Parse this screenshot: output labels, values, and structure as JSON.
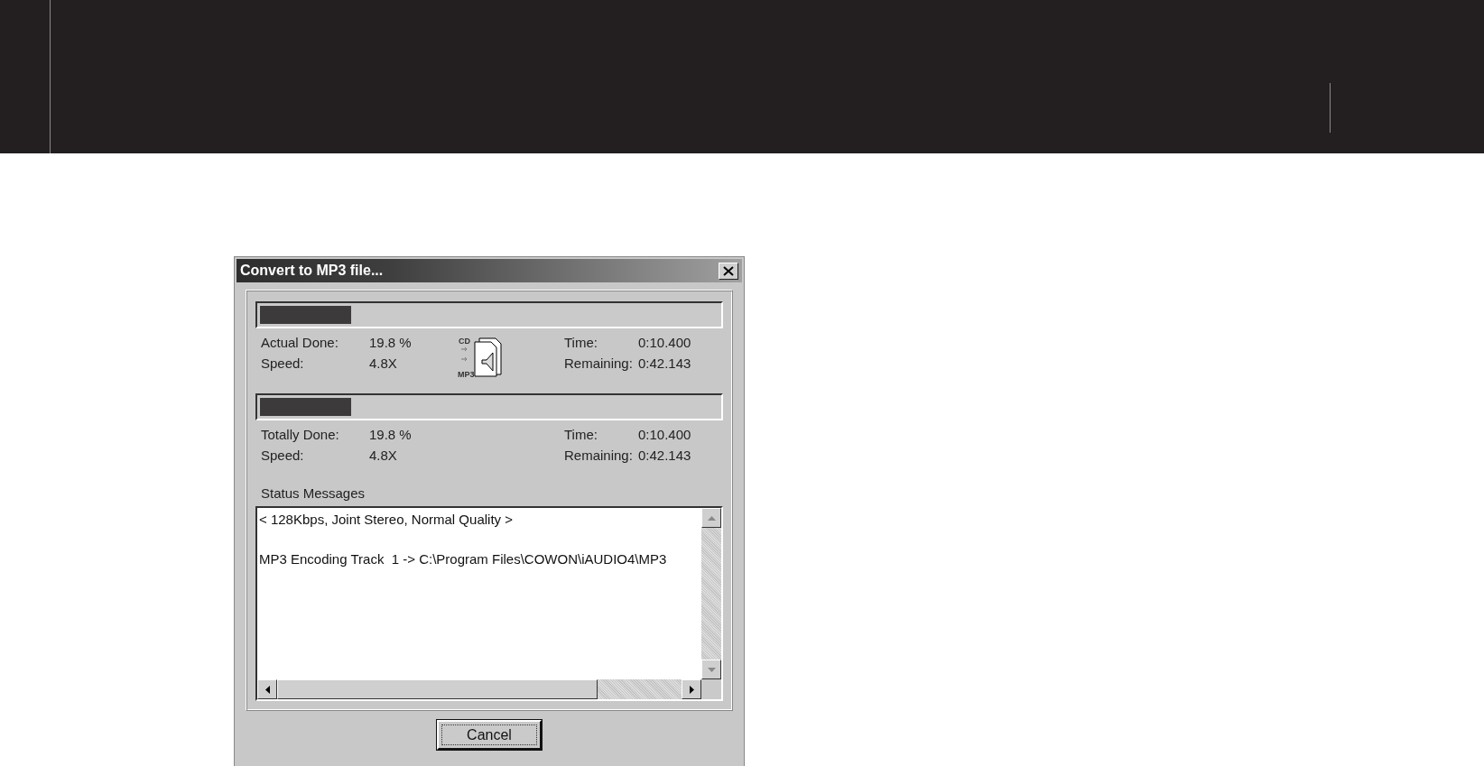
{
  "window": {
    "title": "Convert to MP3 file..."
  },
  "track": {
    "level": 0.198,
    "icon_labels": [
      "CD",
      "MP3"
    ],
    "left": [
      {
        "label": "Actual Done:",
        "value": "19.8 %"
      },
      {
        "label": "Speed:",
        "value": "4.8X"
      }
    ],
    "right": [
      {
        "label": "Time:",
        "value": "0:10.400"
      },
      {
        "label": "Remaining:",
        "value": "0:42.143"
      }
    ]
  },
  "total": {
    "level": 0.198,
    "left": [
      {
        "label": "Totally Done:",
        "value": "19.8 %"
      },
      {
        "label": "Speed:",
        "value": "4.8X"
      }
    ],
    "right": [
      {
        "label": "Time:",
        "value": "0:10.400"
      },
      {
        "label": "Remaining:",
        "value": "0:42.143"
      }
    ]
  },
  "status": {
    "label": "Status Messages",
    "lines": [
      "< 128Kbps, Joint Stereo, Normal Quality >",
      "MP3 Encoding Track  1 -> C:\\Program Files\\COWON\\iAUDIO4\\MP3"
    ]
  },
  "buttons": [
    "Cancel"
  ]
}
